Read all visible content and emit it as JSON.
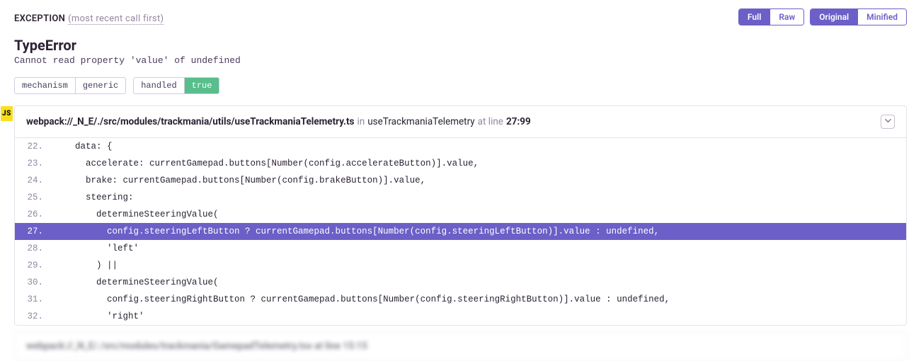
{
  "section": {
    "label": "EXCEPTION",
    "parenthetical": "(most recent call first)"
  },
  "toggles": {
    "full": "Full",
    "raw": "Raw",
    "original": "Original",
    "minified": "Minified"
  },
  "error": {
    "type": "TypeError",
    "message": "Cannot read property 'value' of undefined"
  },
  "tags": {
    "mechanism": {
      "key": "mechanism",
      "value": "generic"
    },
    "handled": {
      "key": "handled",
      "value": "true"
    }
  },
  "badge": "JS",
  "frame": {
    "file": "webpack://_N_E/./src/modules/trackmania/utils/useTrackmaniaTelemetry.ts",
    "in": "in",
    "func": "useTrackmaniaTelemetry",
    "atline": "at line",
    "linecol": "27:99"
  },
  "code": [
    {
      "n": "22.",
      "t": "  data: {"
    },
    {
      "n": "23.",
      "t": "    accelerate: currentGamepad.buttons[Number(config.accelerateButton)].value,"
    },
    {
      "n": "24.",
      "t": "    brake: currentGamepad.buttons[Number(config.brakeButton)].value,"
    },
    {
      "n": "25.",
      "t": "    steering:"
    },
    {
      "n": "26.",
      "t": "      determineSteeringValue("
    },
    {
      "n": "27.",
      "t": "        config.steeringLeftButton ? currentGamepad.buttons[Number(config.steeringLeftButton)].value : undefined,"
    },
    {
      "n": "28.",
      "t": "        'left'"
    },
    {
      "n": "29.",
      "t": "      ) ||"
    },
    {
      "n": "30.",
      "t": "      determineSteeringValue("
    },
    {
      "n": "31.",
      "t": "        config.steeringRightButton ? currentGamepad.buttons[Number(config.steeringRightButton)].value : undefined,"
    },
    {
      "n": "32.",
      "t": "        'right'"
    }
  ],
  "highlight_index": 5,
  "next_frame_preview": "webpack://_N_E/./src/modules/trackmania/GamepadTelemetry.tsx at line 15:15"
}
